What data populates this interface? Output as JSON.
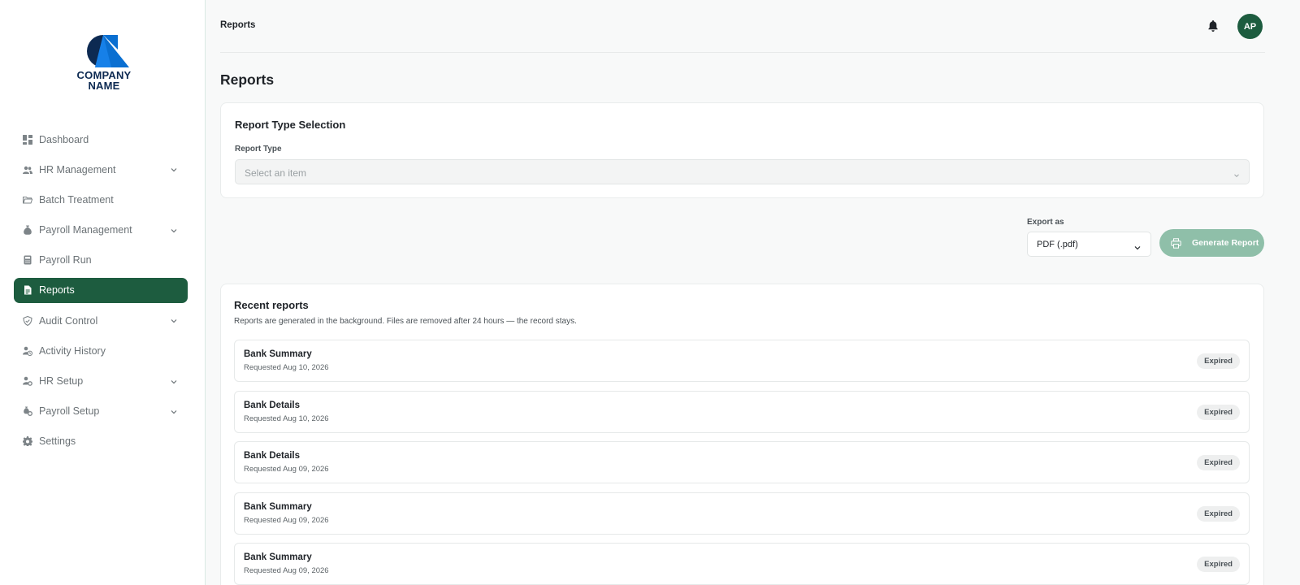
{
  "brand": {
    "name_line1": "COMPANY",
    "name_line2": "NAME",
    "colors": {
      "primary": "#1d5c3f",
      "accent_light": "#8fbfa9",
      "logo_blue": "#0a6fd1",
      "logo_navy": "#0d2a52"
    }
  },
  "sidebar": {
    "items": [
      {
        "label": "Dashboard",
        "icon": "dashboard-icon",
        "expandable": false,
        "active": false
      },
      {
        "label": "HR Management",
        "icon": "people-icon",
        "expandable": true,
        "active": false
      },
      {
        "label": "Batch Treatment",
        "icon": "folder-open-icon",
        "expandable": false,
        "active": false
      },
      {
        "label": "Payroll Management",
        "icon": "money-bag-icon",
        "expandable": true,
        "active": false
      },
      {
        "label": "Payroll Run",
        "icon": "calculator-icon",
        "expandable": false,
        "active": false
      },
      {
        "label": "Reports",
        "icon": "report-icon",
        "expandable": false,
        "active": true
      },
      {
        "label": "Audit Control",
        "icon": "shield-check-icon",
        "expandable": true,
        "active": false
      },
      {
        "label": "Activity History",
        "icon": "user-clock-icon",
        "expandable": false,
        "active": false
      },
      {
        "label": "HR Setup",
        "icon": "user-settings-icon",
        "expandable": true,
        "active": false
      },
      {
        "label": "Payroll Setup",
        "icon": "payroll-settings-icon",
        "expandable": true,
        "active": false
      },
      {
        "label": "Settings",
        "icon": "gear-icon",
        "expandable": false,
        "active": false
      }
    ]
  },
  "header": {
    "breadcrumb": "Reports",
    "avatar_initials": "AP"
  },
  "main": {
    "title": "Reports",
    "report_type_card": {
      "title": "Report Type Selection",
      "field_label": "Report Type",
      "placeholder": "Select an item"
    },
    "export": {
      "label": "Export as",
      "selected": "PDF (.pdf)",
      "generate_label": "Generate Report"
    },
    "recent": {
      "title": "Recent reports",
      "subtitle": "Reports are generated in the background. Files are removed after 24 hours — the record stays.",
      "rows": [
        {
          "name": "Bank Summary",
          "requested": "Requested Aug 10, 2026",
          "status": "Expired"
        },
        {
          "name": "Bank Details",
          "requested": "Requested Aug 10, 2026",
          "status": "Expired"
        },
        {
          "name": "Bank Details",
          "requested": "Requested Aug 09, 2026",
          "status": "Expired"
        },
        {
          "name": "Bank Summary",
          "requested": "Requested Aug 09, 2026",
          "status": "Expired"
        },
        {
          "name": "Bank Summary",
          "requested": "Requested Aug 09, 2026",
          "status": "Expired"
        }
      ]
    }
  }
}
